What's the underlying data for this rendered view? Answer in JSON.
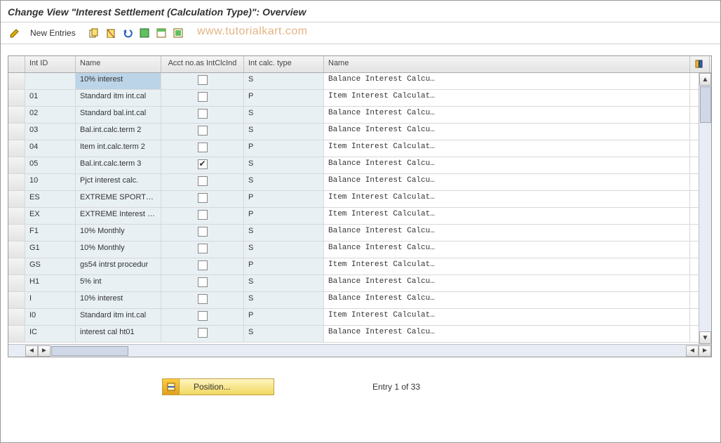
{
  "title": "Change View \"Interest Settlement (Calculation Type)\": Overview",
  "watermark": "www.tutorialkart.com",
  "toolbar": {
    "new_entries_label": "New Entries"
  },
  "columns": {
    "int_id": "Int ID",
    "name": "Name",
    "acct": "Acct no.as IntClcInd",
    "calc_type": "Int calc. type",
    "name2": "Name"
  },
  "rows": [
    {
      "id": "",
      "name1": "10% interest",
      "acct": false,
      "type": "S",
      "name2": "Balance Interest Calcu…",
      "hi": true
    },
    {
      "id": "01",
      "name1": "Standard itm int.cal",
      "acct": false,
      "type": "P",
      "name2": "Item Interest Calculat…"
    },
    {
      "id": "02",
      "name1": "Standard bal.int.cal",
      "acct": false,
      "type": "S",
      "name2": "Balance Interest Calcu…"
    },
    {
      "id": "03",
      "name1": "Bal.int.calc.term 2",
      "acct": false,
      "type": "S",
      "name2": "Balance Interest Calcu…"
    },
    {
      "id": "04",
      "name1": "Item int.calc.term 2",
      "acct": false,
      "type": "P",
      "name2": "Item Interest Calculat…"
    },
    {
      "id": "05",
      "name1": "Bal.int.calc.term 3",
      "acct": true,
      "type": "S",
      "name2": "Balance Interest Calcu…"
    },
    {
      "id": "10",
      "name1": "Pjct interest calc.",
      "acct": false,
      "type": "S",
      "name2": "Balance Interest Calcu…"
    },
    {
      "id": "ES",
      "name1": "EXTREME SPORTS INC",
      "acct": false,
      "type": "P",
      "name2": "Item Interest Calculat…"
    },
    {
      "id": "EX",
      "name1": "EXTREME Interest Std",
      "acct": false,
      "type": "P",
      "name2": "Item Interest Calculat…"
    },
    {
      "id": "F1",
      "name1": "10% Monthly",
      "acct": false,
      "type": "S",
      "name2": "Balance Interest Calcu…"
    },
    {
      "id": "G1",
      "name1": "10% Monthly",
      "acct": false,
      "type": "S",
      "name2": "Balance Interest Calcu…"
    },
    {
      "id": "GS",
      "name1": "gs54 intrst procedur",
      "acct": false,
      "type": "P",
      "name2": "Item Interest Calculat…"
    },
    {
      "id": "H1",
      "name1": "5% int",
      "acct": false,
      "type": "S",
      "name2": "Balance Interest Calcu…"
    },
    {
      "id": "I",
      "name1": "10% interest",
      "acct": false,
      "type": "S",
      "name2": "Balance Interest Calcu…"
    },
    {
      "id": "I0",
      "name1": "Standard itm int.cal",
      "acct": false,
      "type": "P",
      "name2": "Item Interest Calculat…"
    },
    {
      "id": "IC",
      "name1": "interest cal ht01",
      "acct": false,
      "type": "S",
      "name2": "Balance Interest Calcu…"
    }
  ],
  "footer": {
    "position_label": "Position...",
    "entry_text": "Entry 1 of 33"
  }
}
